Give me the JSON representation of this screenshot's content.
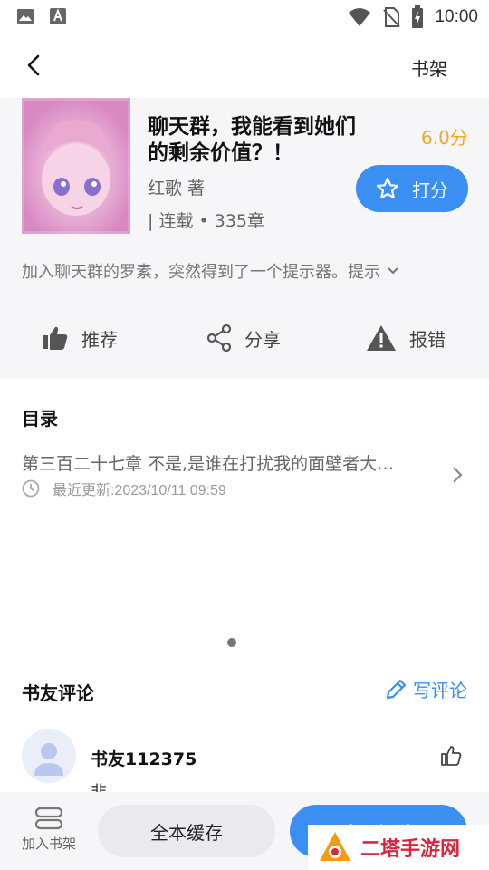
{
  "status_bar": {
    "time": "10:00"
  },
  "header": {
    "bookshelf_label": "书架"
  },
  "book": {
    "title": "聊天群，我能看到她们的剩余价值？！",
    "score": "6.0分",
    "author": "红歌 著",
    "status": "| 连载 • 335章",
    "rate_label": "打分",
    "synopsis": "加入聊天群的罗素，突然得到了一个提示器。提示"
  },
  "actions": [
    {
      "label": "推荐",
      "icon": "thumbs-up-icon"
    },
    {
      "label": "分享",
      "icon": "share-icon"
    },
    {
      "label": "报错",
      "icon": "warning-icon"
    }
  ],
  "catalog": {
    "title": "目录",
    "latest_chapter": "第三百二十七章 不是,是谁在打扰我的面壁者大…",
    "latest_update": "最近更新:2023/10/11 09:59"
  },
  "comments": {
    "title": "书友评论",
    "write_label": "写评论",
    "items": [
      {
        "user": "书友112375",
        "text": "非"
      }
    ]
  },
  "bottom_bar": {
    "add_shelf_label": "加入书架",
    "cache_label": "全本缓存",
    "read_label": "立即阅读"
  },
  "watermark": {
    "text": "二塔手游网"
  },
  "colors": {
    "accent": "#3b8ef2",
    "score": "#f5a623",
    "panel_bg": "#f6f6f8"
  }
}
